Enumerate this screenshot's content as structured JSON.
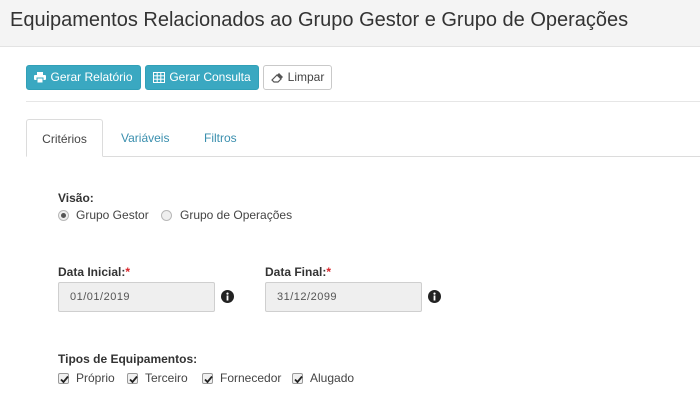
{
  "header": {
    "title": "Equipamentos Relacionados ao Grupo Gestor e Grupo de Operações"
  },
  "toolbar": {
    "report_label": "Gerar Relatório",
    "query_label": "Gerar Consulta",
    "clear_label": "Limpar"
  },
  "tabs": [
    {
      "label": "Critérios",
      "active": true
    },
    {
      "label": "Variáveis",
      "active": false
    },
    {
      "label": "Filtros",
      "active": false
    }
  ],
  "form": {
    "visao": {
      "label": "Visão:",
      "options": [
        {
          "label": "Grupo Gestor",
          "checked": true
        },
        {
          "label": "Grupo de Operações",
          "checked": false
        }
      ]
    },
    "data_inicial": {
      "label": "Data Inicial:",
      "required_mark": "*",
      "value": "01/01/2019"
    },
    "data_final": {
      "label": "Data Final:",
      "required_mark": "*",
      "value": "31/12/2099"
    },
    "tipos": {
      "label": "Tipos de Equipamentos:",
      "options": [
        {
          "label": "Próprio",
          "checked": true
        },
        {
          "label": "Terceiro",
          "checked": true
        },
        {
          "label": "Fornecedor",
          "checked": true
        },
        {
          "label": "Alugado",
          "checked": true
        }
      ]
    }
  },
  "colors": {
    "primary": "#3aa8c1",
    "link": "#3a8fae",
    "required": "#d9262b"
  },
  "icons": {
    "report": "print-icon",
    "query": "table-icon",
    "clear": "eraser-icon",
    "info": "info-circle-icon"
  }
}
